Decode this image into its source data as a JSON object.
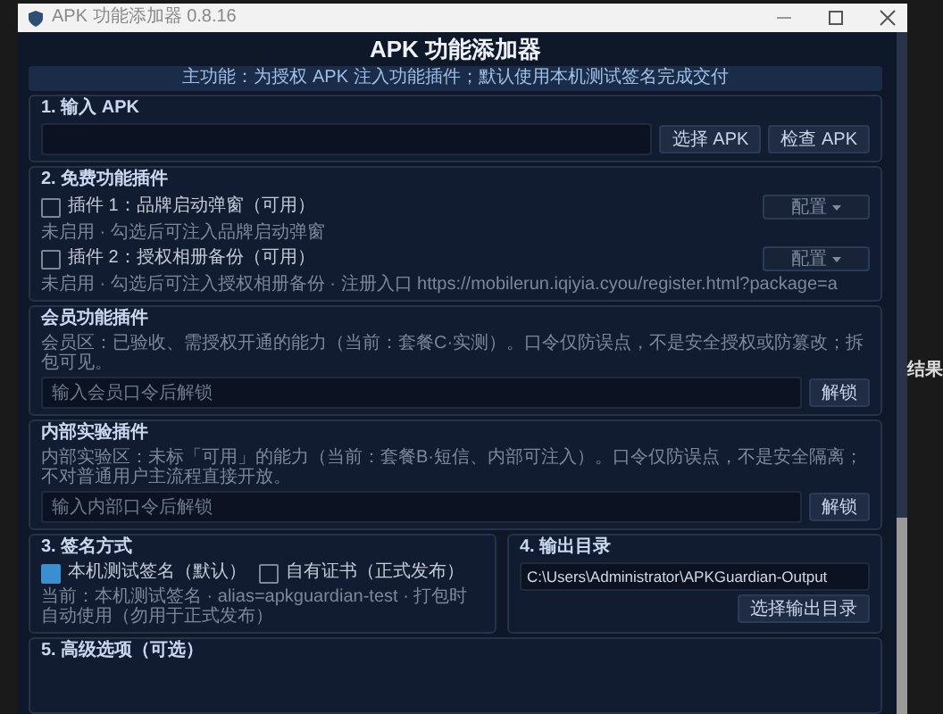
{
  "window": {
    "title": "APK 功能添加器 0.8.16"
  },
  "background": {
    "text": "结果"
  },
  "heading": "APK 功能添加器",
  "banner": "主功能：为授权 APK 注入功能插件；默认使用本机测试签名完成交付",
  "input_section": {
    "legend": "1. 输入 APK",
    "buttons": [
      "选择 APK",
      "检查 APK"
    ]
  },
  "free_plugins": {
    "legend": "2. 免费功能插件",
    "items": [
      {
        "label": "插件 1：品牌启动弹窗（可用）",
        "checked": false,
        "config": "配置",
        "hint": "未启用 · 勾选后可注入品牌启动弹窗"
      },
      {
        "label": "插件 2：授权相册备份（可用）",
        "checked": false,
        "config": "配置",
        "hint": "未启用 · 勾选后可注入授权相册备份 · 注册入口 https://mobilerun.iqiyia.cyou/register.html?package=a"
      }
    ]
  },
  "locked_sections": [
    {
      "legend": "会员功能插件",
      "note": "会员区：已验收、需授权开通的能力（当前：套餐C·实测）。口令仅防误点，不是安全授权或防篡改；拆包可见。",
      "placeholder": "输入会员口令后解锁",
      "button": "解锁"
    },
    {
      "legend": "内部实验插件",
      "note": "内部实验区：未标「可用」的能力（当前：套餐B·短信、内部可注入）。口令仅防误点，不是安全隔离；不对普通用户主流程直接开放。",
      "placeholder": "输入内部口令后解锁",
      "button": "解锁"
    }
  ],
  "signing": {
    "legend": "3. 签名方式",
    "options": [
      {
        "label": "本机测试签名（默认）",
        "selected": true
      },
      {
        "label": "自有证书（正式发布）",
        "selected": false
      }
    ],
    "note": "当前：本机测试签名 · alias=apkguardian-test · 打包时自动使用（勿用于正式发布）"
  },
  "output": {
    "legend": "4. 输出目录",
    "value": "C:\\Users\\Administrator\\APKGuardian-Output",
    "button": "选择输出目录"
  },
  "advanced": {
    "legend": "5. 高级选项（可选）"
  }
}
